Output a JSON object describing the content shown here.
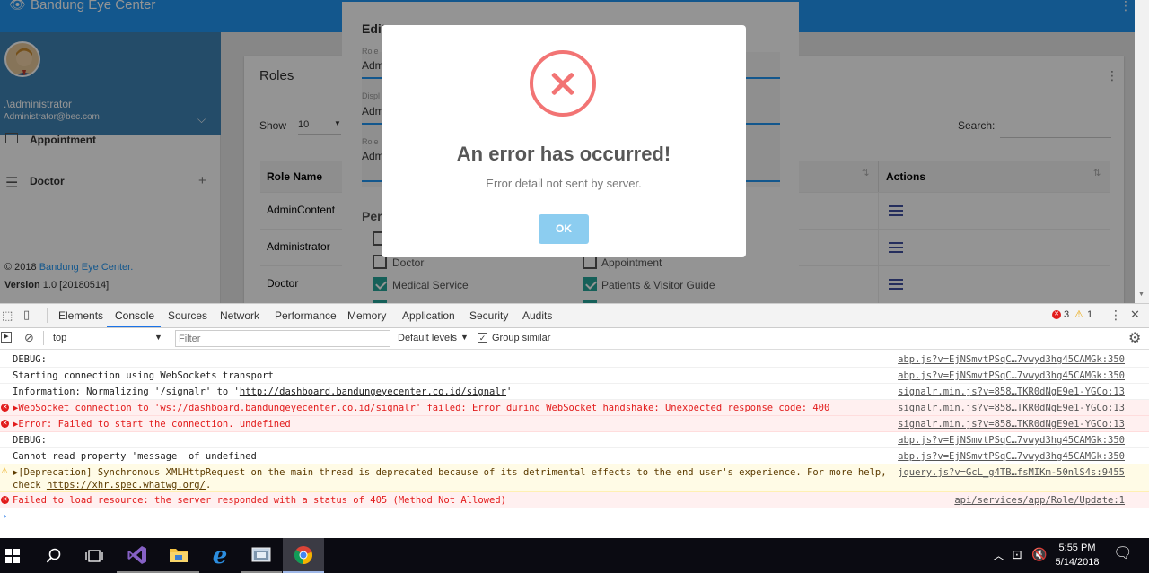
{
  "app": {
    "brand": "Bandung Eye Center",
    "user": {
      "name": ".\\administrator",
      "email": "Administrator@bec.com"
    },
    "sidebar": {
      "items": [
        {
          "label": "Appointment"
        },
        {
          "label": "Doctor"
        }
      ]
    },
    "footer": {
      "copy_prefix": "© 2018 ",
      "copy_link": "Bandung Eye Center.",
      "version_label": "Version",
      "version_value": " 1.0 [20180514]"
    },
    "roles": {
      "title": "Roles",
      "show_label": "Show",
      "page_size": "10",
      "search_label": "Search:",
      "columns": [
        "Role Name",
        "Actions"
      ],
      "rows": [
        "AdminContent",
        "Administrator",
        "Doctor"
      ]
    }
  },
  "edit_dialog": {
    "title": "Edit",
    "fields": [
      {
        "label": "Role",
        "value": "Adm"
      },
      {
        "label": "Displ",
        "value": "Adm"
      },
      {
        "label": "Role",
        "value": "Adm"
      }
    ],
    "permissions_label": "Per",
    "checkboxes": [
      {
        "label": "Doctor",
        "checked": false
      },
      {
        "label": "Appointment",
        "checked": false
      },
      {
        "label": "Medical Service",
        "checked": true
      },
      {
        "label": "Patients & Visitor Guide",
        "checked": true
      }
    ]
  },
  "alert": {
    "title": "An error has occurred!",
    "text": "Error detail not sent by server.",
    "ok_label": "OK",
    "accent": "#f27474"
  },
  "devtools": {
    "tabs": [
      "Elements",
      "Console",
      "Sources",
      "Network",
      "Performance",
      "Memory",
      "Application",
      "Security",
      "Audits"
    ],
    "active_tab": "Console",
    "error_count": "3",
    "warning_count": "1",
    "context": "top",
    "filter_placeholder": "Filter",
    "levels": "Default levels",
    "group_similar": "Group similar",
    "lines": [
      {
        "type": "log",
        "msg": "DEBUG:",
        "src": "abp.js?v=EjNSmvtPSqC…7vwyd3hg45CAMGk:350"
      },
      {
        "type": "log",
        "msg": "Starting connection using WebSockets transport",
        "src": "abp.js?v=EjNSmvtPSqC…7vwyd3hg45CAMGk:350"
      },
      {
        "type": "log",
        "msg": "Information: Normalizing '/signalr' to '",
        "link": "http://dashboard.bandungeyecenter.co.id/signalr",
        "msg_end": "'",
        "src": "signalr.min.js?v=858…TKR0dNgE9e1-YGCo:13"
      },
      {
        "type": "error",
        "msg": "▶WebSocket connection to 'ws://dashboard.bandungeyecenter.co.id/signalr' failed: Error during WebSocket handshake: Unexpected response code: 400",
        "src": "signalr.min.js?v=858…TKR0dNgE9e1-YGCo:13"
      },
      {
        "type": "error",
        "msg": "▶Error: Failed to start the connection. undefined",
        "src": "signalr.min.js?v=858…TKR0dNgE9e1-YGCo:13"
      },
      {
        "type": "log",
        "msg": "DEBUG:",
        "src": "abp.js?v=EjNSmvtPSqC…7vwyd3hg45CAMGk:350"
      },
      {
        "type": "log",
        "msg": "Cannot read property 'message' of undefined",
        "src": "abp.js?v=EjNSmvtPSqC…7vwyd3hg45CAMGk:350"
      },
      {
        "type": "warn",
        "msg": "▶[Deprecation] Synchronous XMLHttpRequest on the main thread is deprecated because of its detrimental effects to the end user's experience. For more help,",
        "msg2": "check ",
        "link": "https://xhr.spec.whatwg.org/",
        "msg_end": ".",
        "src": "jquery.js?v=GcL_g4TB…fsMIKm-50nlS4s:9455"
      },
      {
        "type": "error",
        "msg": "Failed to load resource: the server responded with a status of 405 (Method Not Allowed)",
        "src": "api/services/app/Role/Update:1"
      }
    ]
  },
  "taskbar": {
    "time": "5:55 PM",
    "date": "5/14/2018"
  }
}
